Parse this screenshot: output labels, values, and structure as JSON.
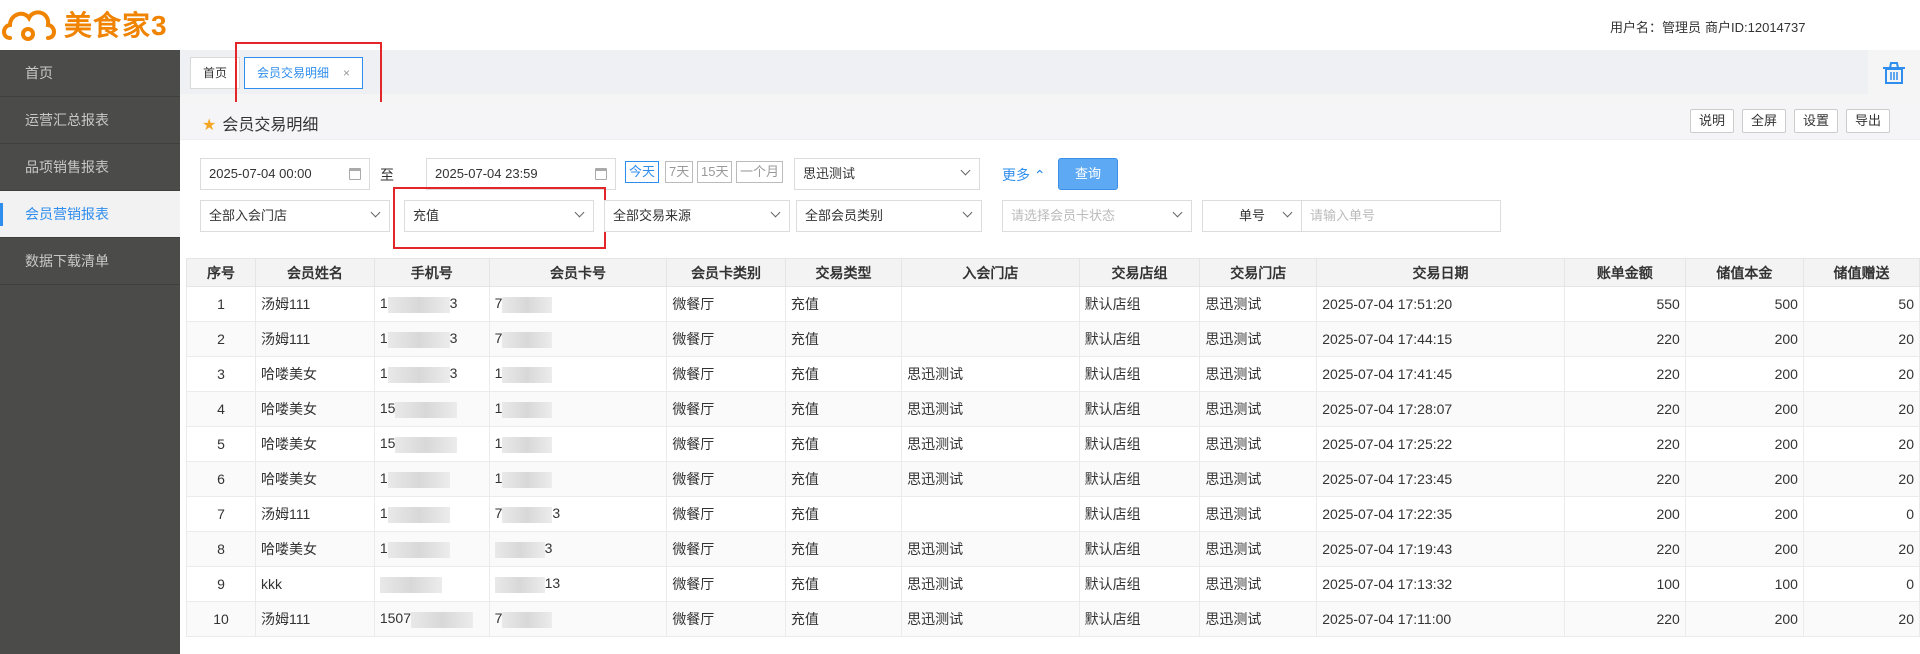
{
  "app": {
    "name": "美食家3"
  },
  "topbar": {
    "user_label": "用户名：管理员",
    "merchant_label": "商户ID:12014737"
  },
  "sidebar": {
    "items": [
      {
        "label": "首页"
      },
      {
        "label": "运营汇总报表"
      },
      {
        "label": "品项销售报表"
      },
      {
        "label": "会员营销报表",
        "active": true
      },
      {
        "label": "数据下载清单"
      }
    ]
  },
  "tabs": [
    {
      "label": "首页"
    },
    {
      "label": "会员交易明细",
      "close": "×",
      "active": true
    }
  ],
  "page": {
    "title": "会员交易明细",
    "buttons": {
      "help": "说明",
      "fullscreen": "全屏",
      "settings": "设置",
      "export": "导出"
    }
  },
  "filters": {
    "start_date": "2025-07-04 00:00",
    "to": "至",
    "end_date": "2025-07-04 23:59",
    "quick": [
      "今天",
      "7天",
      "15天",
      "一个月"
    ],
    "store": "思迅测试",
    "more": "更多",
    "query": "查询",
    "join_store": "全部入会门店",
    "trans_type": "充值",
    "trans_source": "全部交易来源",
    "card_type": "全部会员类别",
    "card_status_placeholder": "请选择会员卡状态",
    "order_field": "单号",
    "order_placeholder": "请输入单号"
  },
  "table": {
    "columns": [
      "序号",
      "会员姓名",
      "手机号",
      "会员卡号",
      "会员卡类别",
      "交易类型",
      "入会门店",
      "交易店组",
      "交易门店",
      "交易日期",
      "账单金额",
      "储值本金",
      "储值赠送"
    ],
    "rows": [
      {
        "no": "1",
        "name": "汤姆111",
        "phone": "1",
        "phone_tail": "3",
        "card": "7",
        "card_tail": "",
        "card_type": "微餐厅",
        "type": "充值",
        "join_store": "",
        "group": "默认店组",
        "store": "思迅测试",
        "date": "2025-07-04 17:51:20",
        "amount": "550",
        "principal": "500",
        "gift": "50"
      },
      {
        "no": "2",
        "name": "汤姆111",
        "phone": "1",
        "phone_tail": "3",
        "card": "7",
        "card_tail": "",
        "card_type": "微餐厅",
        "type": "充值",
        "join_store": "",
        "group": "默认店组",
        "store": "思迅测试",
        "date": "2025-07-04 17:44:15",
        "amount": "220",
        "principal": "200",
        "gift": "20"
      },
      {
        "no": "3",
        "name": "哈喽美女",
        "phone": "1",
        "phone_tail": "3",
        "card": "1",
        "card_tail": "",
        "card_type": "微餐厅",
        "type": "充值",
        "join_store": "思迅测试",
        "group": "默认店组",
        "store": "思迅测试",
        "date": "2025-07-04 17:41:45",
        "amount": "220",
        "principal": "200",
        "gift": "20"
      },
      {
        "no": "4",
        "name": "哈喽美女",
        "phone": "15",
        "phone_tail": "",
        "card": "1",
        "card_tail": "",
        "card_type": "微餐厅",
        "type": "充值",
        "join_store": "思迅测试",
        "group": "默认店组",
        "store": "思迅测试",
        "date": "2025-07-04 17:28:07",
        "amount": "220",
        "principal": "200",
        "gift": "20"
      },
      {
        "no": "5",
        "name": "哈喽美女",
        "phone": "15",
        "phone_tail": "",
        "card": "1",
        "card_tail": "",
        "card_type": "微餐厅",
        "type": "充值",
        "join_store": "思迅测试",
        "group": "默认店组",
        "store": "思迅测试",
        "date": "2025-07-04 17:25:22",
        "amount": "220",
        "principal": "200",
        "gift": "20"
      },
      {
        "no": "6",
        "name": "哈喽美女",
        "phone": "1",
        "phone_tail": "",
        "card": "1",
        "card_tail": "",
        "card_type": "微餐厅",
        "type": "充值",
        "join_store": "思迅测试",
        "group": "默认店组",
        "store": "思迅测试",
        "date": "2025-07-04 17:23:45",
        "amount": "220",
        "principal": "200",
        "gift": "20"
      },
      {
        "no": "7",
        "name": "汤姆111",
        "phone": "1",
        "phone_tail": "",
        "card": "7",
        "card_tail": "3",
        "card_type": "微餐厅",
        "type": "充值",
        "join_store": "",
        "group": "默认店组",
        "store": "思迅测试",
        "date": "2025-07-04 17:22:35",
        "amount": "200",
        "principal": "200",
        "gift": "0"
      },
      {
        "no": "8",
        "name": "哈喽美女",
        "phone": "1",
        "phone_tail": "",
        "card": "",
        "card_tail": "3",
        "card_type": "微餐厅",
        "type": "充值",
        "join_store": "思迅测试",
        "group": "默认店组",
        "store": "思迅测试",
        "date": "2025-07-04 17:19:43",
        "amount": "220",
        "principal": "200",
        "gift": "20"
      },
      {
        "no": "9",
        "name": "kkk",
        "phone": "",
        "phone_tail": "",
        "card": "",
        "card_tail": "13",
        "card_type": "微餐厅",
        "type": "充值",
        "join_store": "思迅测试",
        "group": "默认店组",
        "store": "思迅测试",
        "date": "2025-07-04 17:13:32",
        "amount": "100",
        "principal": "100",
        "gift": "0"
      },
      {
        "no": "10",
        "name": "汤姆111",
        "phone": "1507",
        "phone_tail": "",
        "card": "7",
        "card_tail": "",
        "card_type": "微餐厅",
        "type": "充值",
        "join_store": "思迅测试",
        "group": "默认店组",
        "store": "思迅测试",
        "date": "2025-07-04 17:11:00",
        "amount": "220",
        "principal": "200",
        "gift": "20"
      }
    ]
  },
  "colors": {
    "accent": "#2e8ded",
    "brand": "#f08300",
    "highlight": "#e3262a",
    "sidebar": "#4b4b49"
  },
  "icons": {
    "logo": "cloud-logo-icon",
    "trash": "trash-icon",
    "star": "star-icon",
    "calendar": "calendar-icon"
  }
}
